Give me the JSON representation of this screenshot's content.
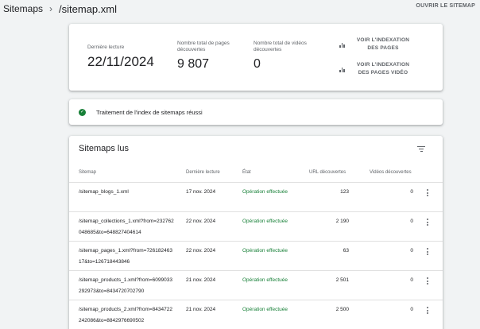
{
  "breadcrumb": {
    "parent": "Sitemaps",
    "separator": "›",
    "current": "/sitemap.xml"
  },
  "header": {
    "open_sitemap": "OUVRIR LE SITEMAP"
  },
  "summary": {
    "last_read_label": "Dernière lecture",
    "last_read_value": "22/11/2024",
    "pages_label": "Nombre total de pages découvertes",
    "pages_value": "9 807",
    "videos_label": "Nombre total de vidéos découvertes",
    "videos_value": "0",
    "action_pages": "VOIR L'INDEXATION DES PAGES",
    "action_videos": "VOIR L'INDEXATION DES PAGES VIDÉO"
  },
  "status": {
    "text": "Traitement de l'index de sitemaps réussi",
    "icon": "check-circle-icon",
    "color": "#188038"
  },
  "table": {
    "title": "Sitemaps lus",
    "columns": [
      "Sitemap",
      "Dernière lecture",
      "État",
      "URL découvertes",
      "Vidéos découvertes"
    ],
    "rows": [
      {
        "sitemap": "/sitemap_blogs_1.xml",
        "date": "17 nov. 2024",
        "state": "Opération effectuée",
        "urls": "123",
        "videos": "0"
      },
      {
        "sitemap": "/sitemap_collections_1.xml?from=232762048685&to=648827404614",
        "date": "22 nov. 2024",
        "state": "Opération effectuée",
        "urls": "2 190",
        "videos": "0"
      },
      {
        "sitemap": "/sitemap_pages_1.xml?from=72618246317&to=126718443846",
        "date": "22 nov. 2024",
        "state": "Opération effectuée",
        "urls": "63",
        "videos": "0"
      },
      {
        "sitemap": "/sitemap_products_1.xml?from=6099033292973&to=8434720702790",
        "date": "21 nov. 2024",
        "state": "Opération effectuée",
        "urls": "2 501",
        "videos": "0"
      },
      {
        "sitemap": "/sitemap_products_2.xml?from=8434722242086&to=8842976690502",
        "date": "21 nov. 2024",
        "state": "Opération effectuée",
        "urls": "2 500",
        "videos": "0"
      }
    ]
  },
  "colors": {
    "success": "#188038",
    "muted": "#5f6368",
    "background": "#f1f3f4"
  }
}
